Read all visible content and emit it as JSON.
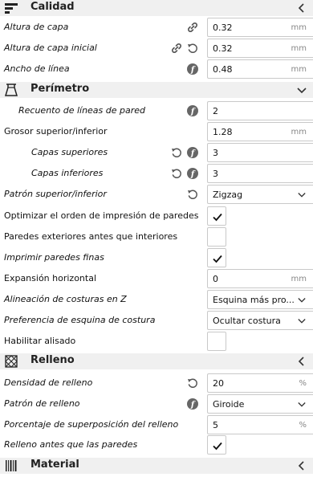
{
  "sections": {
    "calidad": {
      "title": "Calidad"
    },
    "perimetro": {
      "title": "Perímetro"
    },
    "relleno": {
      "title": "Relleno"
    },
    "material": {
      "title": "Material"
    }
  },
  "rows": {
    "altura_capa": {
      "label": "Altura de capa",
      "value": "0.32",
      "unit": "mm"
    },
    "altura_capa_inicial": {
      "label": "Altura de capa inicial",
      "value": "0.32",
      "unit": "mm"
    },
    "ancho_linea": {
      "label": "Ancho de línea",
      "value": "0.48",
      "unit": "mm"
    },
    "recuento_lineas_pared": {
      "label": "Recuento de líneas de pared",
      "value": "2"
    },
    "grosor_sup_inf": {
      "label": "Grosor superior/inferior",
      "value": "1.28",
      "unit": "mm"
    },
    "capas_superiores": {
      "label": "Capas superiores",
      "value": "3"
    },
    "capas_inferiores": {
      "label": "Capas inferiores",
      "value": "3"
    },
    "patron_sup_inf": {
      "label": "Patrón superior/inferior",
      "value": "Zigzag"
    },
    "optimizar_orden": {
      "label": "Optimizar el orden de impresión de paredes",
      "checked": true
    },
    "paredes_exteriores": {
      "label": "Paredes exteriores antes que interiores",
      "checked": false
    },
    "imprimir_paredes_finas": {
      "label": "Imprimir paredes finas",
      "checked": true
    },
    "expansion_horizontal": {
      "label": "Expansión horizontal",
      "value": "0",
      "unit": "mm"
    },
    "alineacion_costuras": {
      "label": "Alineación de costuras en Z",
      "value": "Esquina más pro..."
    },
    "preferencia_esquina": {
      "label": "Preferencia de esquina de costura",
      "value": "Ocultar costura"
    },
    "habilitar_alisado": {
      "label": "Habilitar alisado",
      "checked": false
    },
    "densidad_relleno": {
      "label": "Densidad de relleno",
      "value": "20",
      "unit": "%"
    },
    "patron_relleno": {
      "label": "Patrón de relleno",
      "value": "Giroide"
    },
    "porcentaje_superposicion": {
      "label": "Porcentaje de superposición del relleno",
      "value": "5",
      "unit": "%"
    },
    "relleno_antes_paredes": {
      "label": "Relleno antes que las paredes",
      "checked": true
    }
  },
  "icons": {
    "link": "link-icon",
    "reset": "reset-icon",
    "function": "function-icon",
    "chevron_left": "chevron-left-icon",
    "chevron_down": "chevron-down-icon"
  },
  "colors": {
    "header_bg": "#f0f0f0",
    "field_border": "#c9c9c9",
    "icon_dark": "#555555"
  }
}
